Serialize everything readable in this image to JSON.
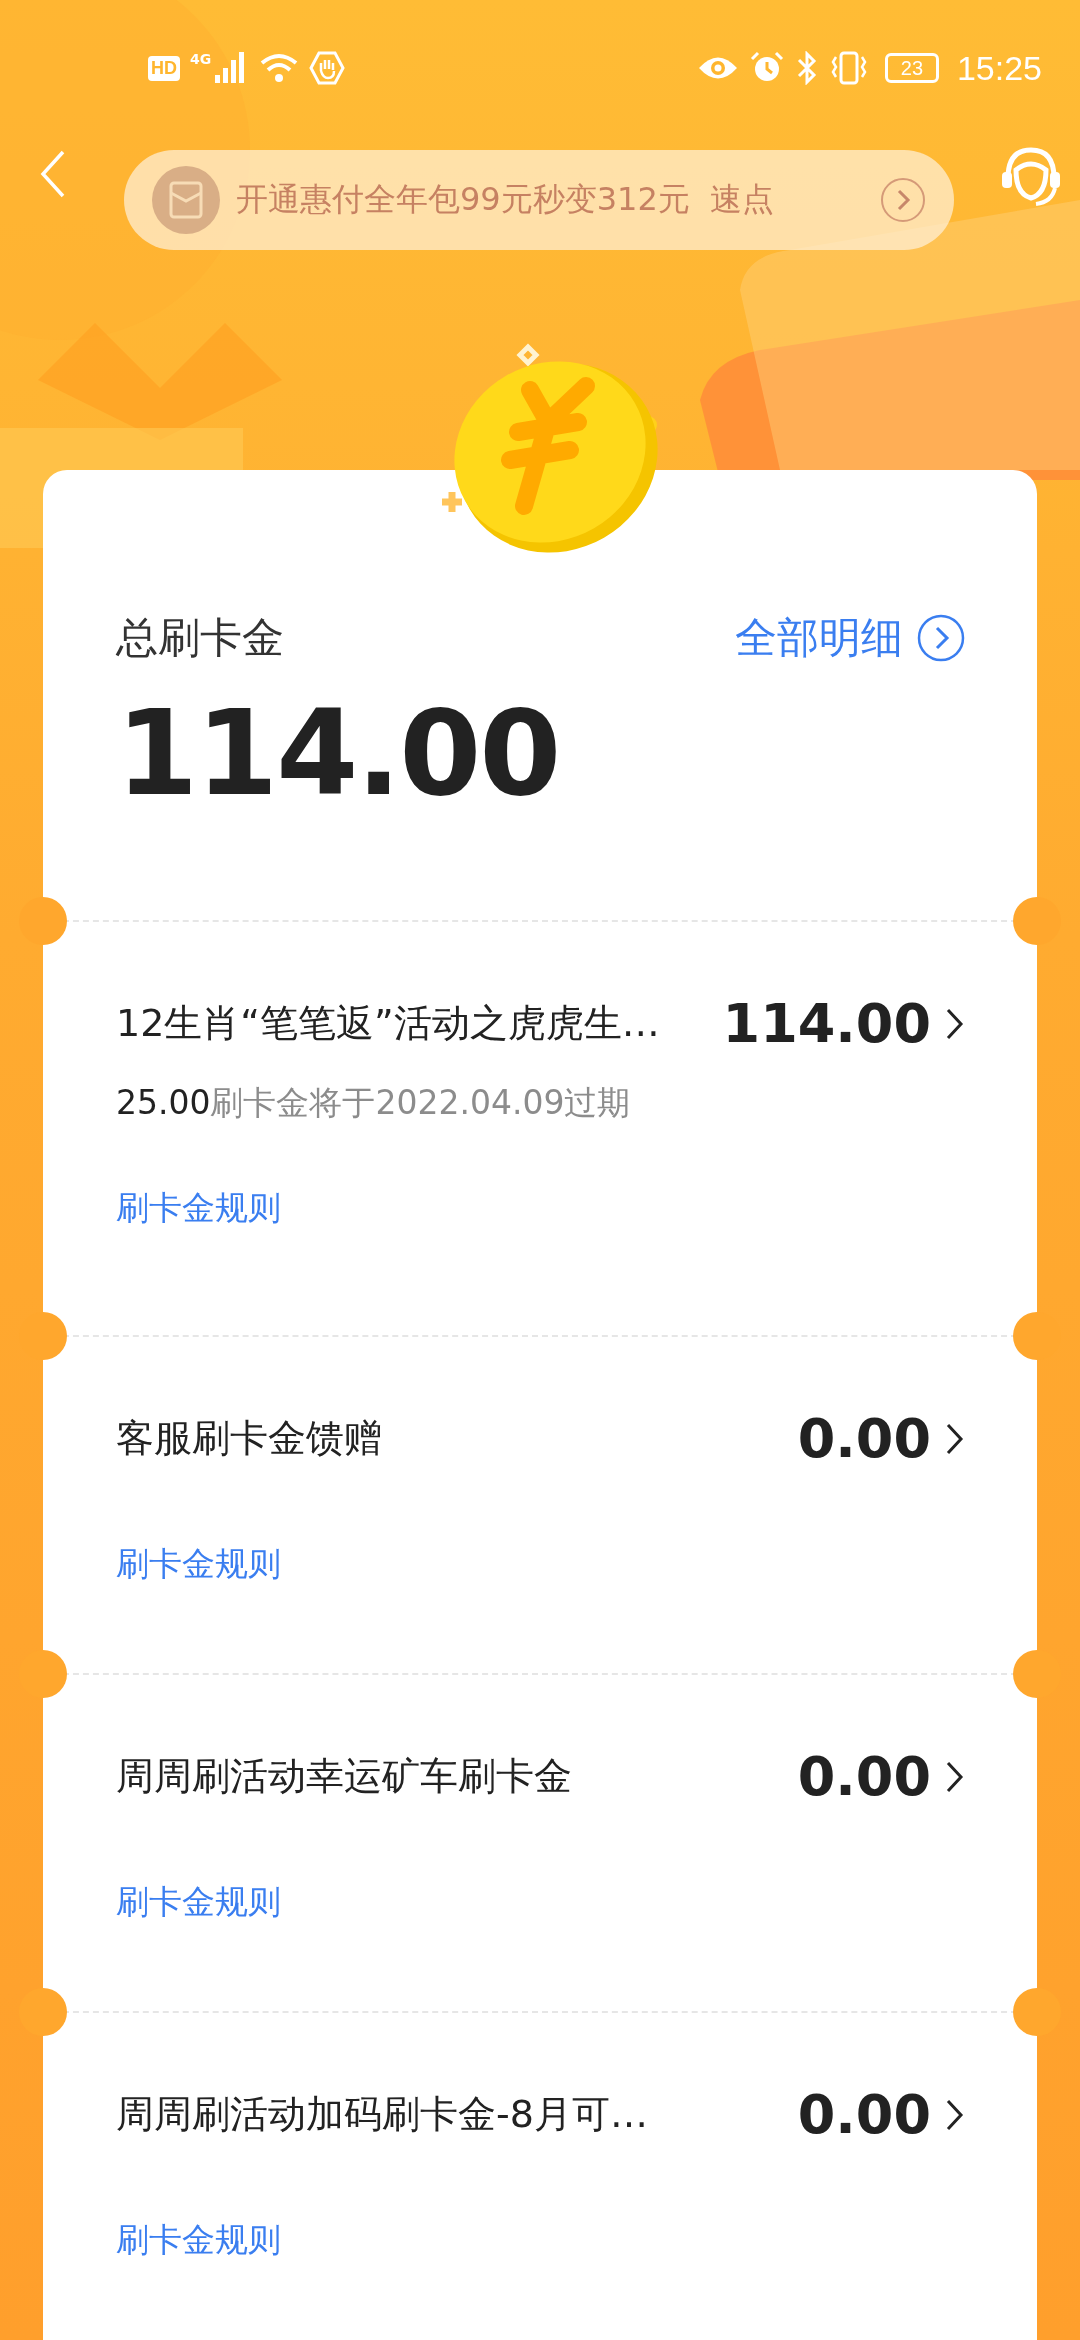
{
  "status_bar": {
    "hd": "HD",
    "network": "4G",
    "battery": "23",
    "time": "15:25"
  },
  "promo_banner": {
    "text": "开通惠付全年包99元秒变312元",
    "action": "速点"
  },
  "summary": {
    "label": "总刷卡金",
    "amount": "114.00",
    "details_link": "全部明细"
  },
  "items": [
    {
      "title": "12生肖“笔笔返”活动之虎虎生…",
      "amount": "114.00",
      "expiring_amount": "25.00",
      "expiry_note": "刷卡金将于2022.04.09过期",
      "rule_link": "刷卡金规则"
    },
    {
      "title": "客服刷卡金馈赠",
      "amount": "0.00",
      "rule_link": "刷卡金规则"
    },
    {
      "title": "周周刷活动幸运矿车刷卡金",
      "amount": "0.00",
      "rule_link": "刷卡金规则"
    },
    {
      "title": "周周刷活动加码刷卡金-8月可…",
      "amount": "0.00",
      "rule_link": "刷卡金规则"
    }
  ]
}
